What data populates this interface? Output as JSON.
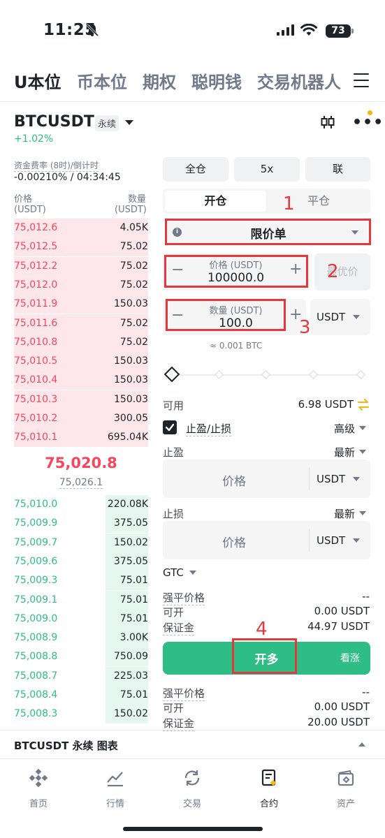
{
  "status_bar": {
    "time": "11:25",
    "battery": "73"
  },
  "top_tabs": [
    "U本位",
    "币本位",
    "期权",
    "聪明钱",
    "交易机器人"
  ],
  "symbol": {
    "name": "BTCUSDT",
    "type_badge": "永续",
    "change": "+1.02%"
  },
  "funding": {
    "label": "资金费率 (8时)/倒计时",
    "value": "-0.00210% / 04:34:45"
  },
  "orderbook": {
    "price_header": "价格",
    "price_unit": "(USDT)",
    "qty_header": "数量",
    "qty_unit": "(USDT)",
    "asks": [
      {
        "price": "75,012.6",
        "qty": "4.05K",
        "depth": 1.0
      },
      {
        "price": "75,012.5",
        "qty": "75.02",
        "depth": 1.0
      },
      {
        "price": "75,012.2",
        "qty": "75.02",
        "depth": 1.0
      },
      {
        "price": "75,012.0",
        "qty": "75.02",
        "depth": 1.0
      },
      {
        "price": "75,011.9",
        "qty": "150.03",
        "depth": 1.0
      },
      {
        "price": "75,011.6",
        "qty": "75.02",
        "depth": 1.0
      },
      {
        "price": "75,010.8",
        "qty": "75.02",
        "depth": 1.0
      },
      {
        "price": "75,010.5",
        "qty": "150.03",
        "depth": 1.0
      },
      {
        "price": "75,010.4",
        "qty": "150.03",
        "depth": 1.0
      },
      {
        "price": "75,010.3",
        "qty": "150.03",
        "depth": 1.0
      },
      {
        "price": "75,010.2",
        "qty": "300.05",
        "depth": 1.0
      },
      {
        "price": "75,010.1",
        "qty": "695.04K",
        "depth": 1.0
      }
    ],
    "last_price": "75,020.8",
    "mark_price": "75,026.1",
    "bids": [
      {
        "price": "75,010.0",
        "qty": "220.08K",
        "depth": 0.32
      },
      {
        "price": "75,009.9",
        "qty": "375.05",
        "depth": 0.32
      },
      {
        "price": "75,009.7",
        "qty": "150.02",
        "depth": 0.32
      },
      {
        "price": "75,009.6",
        "qty": "375.05",
        "depth": 0.32
      },
      {
        "price": "75,009.3",
        "qty": "75.01",
        "depth": 0.32
      },
      {
        "price": "75,009.1",
        "qty": "75.01",
        "depth": 0.32
      },
      {
        "price": "75,009.0",
        "qty": "75.01",
        "depth": 0.32
      },
      {
        "price": "75,008.9",
        "qty": "3.00K",
        "depth": 0.32
      },
      {
        "price": "75,008.8",
        "qty": "750.09",
        "depth": 0.32
      },
      {
        "price": "75,008.7",
        "qty": "225.03",
        "depth": 0.32
      },
      {
        "price": "75,008.4",
        "qty": "75.01",
        "depth": 0.32
      },
      {
        "price": "75,008.3",
        "qty": "150.02",
        "depth": 0.32
      }
    ]
  },
  "controls": {
    "margin_mode": "全仓",
    "leverage": "5x",
    "position_mode": "联"
  },
  "open_close": {
    "open": "开仓",
    "close": "平仓"
  },
  "order_type": "限价单",
  "price_field": {
    "label": "价格 (USDT)",
    "value": "100000.0",
    "best": "最优价"
  },
  "qty_field": {
    "label": "数量 (USDT)",
    "value": "100.0",
    "unit": "USDT",
    "approx": "≈ 0.001 BTC"
  },
  "available": {
    "label": "可用",
    "value": "6.98 USDT"
  },
  "tpsl": {
    "label": "止盈/止损",
    "mode": "高级",
    "tp_label": "止盈",
    "tp_trigger": "最新",
    "tp_placeholder": "价格",
    "tp_unit": "USDT",
    "sl_label": "止损",
    "sl_trigger": "最新",
    "sl_placeholder": "价格",
    "sl_unit": "USDT"
  },
  "tif": "GTC",
  "long_info": {
    "liq_label": "强平价格",
    "liq_value": "--",
    "open_label": "可开",
    "open_value": "0.00 USDT",
    "margin_label": "保证金",
    "margin_value": "44.97 USDT"
  },
  "buy_button": {
    "label": "开多",
    "side": "看涨"
  },
  "short_info": {
    "liq_label": "强平价格",
    "liq_value": "--",
    "open_label": "可开",
    "open_value": "0.00 USDT",
    "margin_label": "保证金",
    "margin_value": "20.00 USDT"
  },
  "annotations": [
    "1",
    "2",
    "3",
    "4"
  ],
  "chart_bar": "BTCUSDT 永续 图表",
  "bottom_nav": [
    {
      "label": "首页",
      "icon": "home-icon"
    },
    {
      "label": "行情",
      "icon": "markets-icon"
    },
    {
      "label": "交易",
      "icon": "trade-icon"
    },
    {
      "label": "合约",
      "icon": "futures-icon"
    },
    {
      "label": "资产",
      "icon": "wallet-icon"
    }
  ],
  "colors": {
    "buy": "#2ebd85",
    "sell": "#f6465d",
    "accent": "#f0b90b",
    "annotation": "#e5383b"
  }
}
